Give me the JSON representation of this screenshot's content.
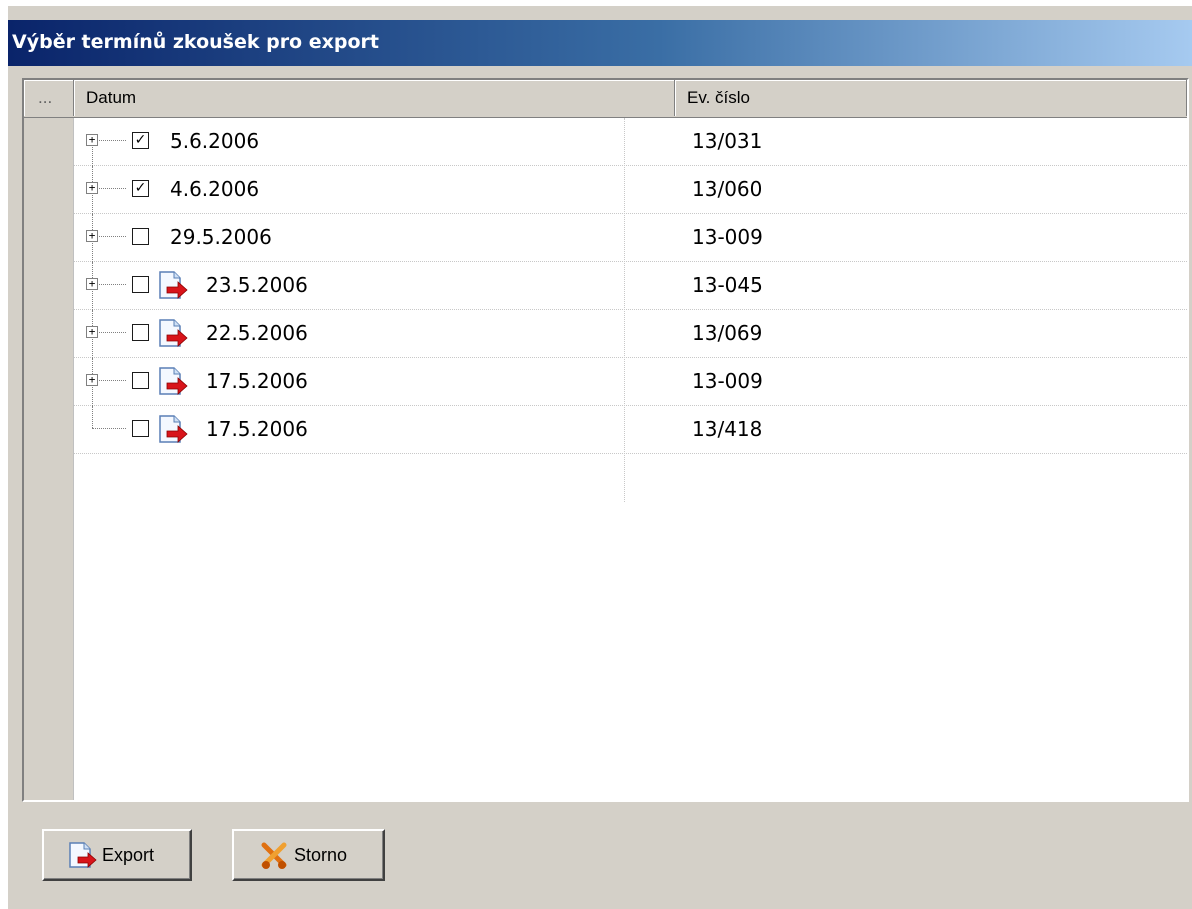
{
  "window": {
    "title": "Výběr termínů zkoušek pro export"
  },
  "grid": {
    "indicator_header": "...",
    "columns": [
      "Datum",
      "Ev. číslo"
    ],
    "rows": [
      {
        "date": "5.6.2006",
        "ev": "13/031",
        "checked": true,
        "has_children": true,
        "export_icon": false
      },
      {
        "date": "4.6.2006",
        "ev": "13/060",
        "checked": true,
        "has_children": true,
        "export_icon": false
      },
      {
        "date": "29.5.2006",
        "ev": "13-009",
        "checked": false,
        "has_children": true,
        "export_icon": false
      },
      {
        "date": "23.5.2006",
        "ev": "13-045",
        "checked": false,
        "has_children": true,
        "export_icon": true
      },
      {
        "date": "22.5.2006",
        "ev": "13/069",
        "checked": false,
        "has_children": true,
        "export_icon": true
      },
      {
        "date": "17.5.2006",
        "ev": "13-009",
        "checked": false,
        "has_children": true,
        "export_icon": true
      },
      {
        "date": "17.5.2006",
        "ev": "13/418",
        "checked": false,
        "has_children": false,
        "export_icon": true
      }
    ]
  },
  "buttons": {
    "export_label": "Export",
    "cancel_label": "Storno"
  },
  "icons": {
    "expander": "plus-box-icon",
    "checkbox_mark": "✓",
    "row_icon": "export-document-icon",
    "export_button_icon": "export-document-icon",
    "cancel_button_icon": "cancel-scissors-icon"
  },
  "colors": {
    "title_gradient_start": "#0a246a",
    "title_gradient_end": "#a6caf0",
    "arrow_red": "#d8141a"
  }
}
